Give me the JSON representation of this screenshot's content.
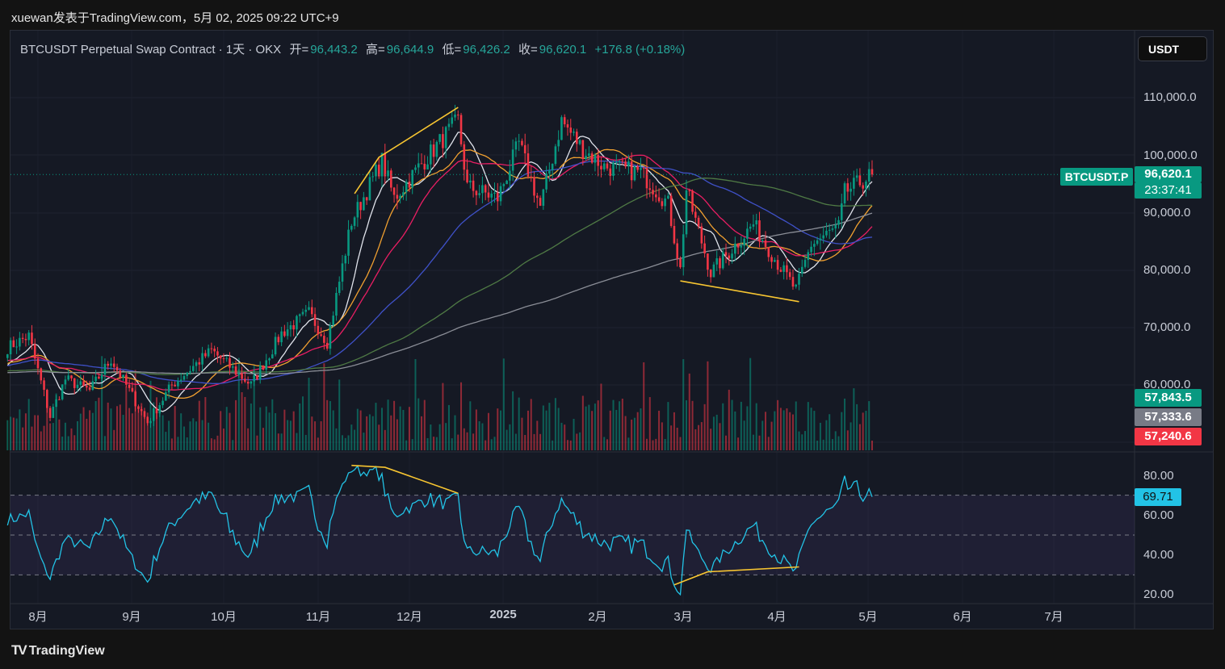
{
  "publisher_line": "xuewan发表于TradingView.com，5月 02, 2025 09:22 UTC+9",
  "legend": {
    "symbol": "BTCUSDT Perpetual Swap Contract · 1天 · OKX",
    "open_label": "开=",
    "open": "96,443.2",
    "high_label": "高=",
    "high": "96,644.9",
    "low_label": "低=",
    "low": "96,426.2",
    "close_label": "收=",
    "close": "96,620.1",
    "change": "+176.8 (+0.18%)"
  },
  "currency_button": "USDT",
  "price_axis": [
    "110,000.0",
    "100,000.0",
    "90,000.0",
    "80,000.0",
    "70,000.0",
    "60,000.0"
  ],
  "symbol_tag": "BTCUSDT.P",
  "last_price": "96,620.1",
  "countdown": "23:37:41",
  "ma_tags": [
    {
      "value": "57,843.5",
      "color": "#089981"
    },
    {
      "value": "57,333.6",
      "color": "#787b86"
    },
    {
      "value": "57,240.6",
      "color": "#f23645"
    }
  ],
  "rsi_axis": [
    "80.00",
    "60.00",
    "40.00",
    "20.00"
  ],
  "rsi_value": "69.71",
  "time_axis": [
    "8月",
    "9月",
    "10月",
    "11月",
    "12月",
    "2025",
    "2月",
    "3月",
    "4月",
    "5月",
    "6月",
    "7月"
  ],
  "brand": "TradingView",
  "colors": {
    "up": "#089981",
    "down": "#f23645",
    "trendline": "#f7c531",
    "rsi": "#22c3e6"
  },
  "chart_data": {
    "type": "candlestick",
    "title": "BTCUSDT Perpetual Swap Contract · 1天 · OKX",
    "y_range": [
      55000,
      115000
    ],
    "rsi_range": [
      15,
      90
    ],
    "rsi_levels": [
      70,
      50,
      30
    ],
    "x_range": [
      "2024-07-22",
      "2025-07-31"
    ],
    "price_path": [
      [
        "2024-07-22",
        66500
      ],
      [
        "2024-07-29",
        68500
      ],
      [
        "2024-08-05",
        54500
      ],
      [
        "2024-08-10",
        61000
      ],
      [
        "2024-08-18",
        59000
      ],
      [
        "2024-08-25",
        64500
      ],
      [
        "2024-09-06",
        53500
      ],
      [
        "2024-09-14",
        60000
      ],
      [
        "2024-09-27",
        66000
      ],
      [
        "2024-10-10",
        60000
      ],
      [
        "2024-10-20",
        69000
      ],
      [
        "2024-10-29",
        72500
      ],
      [
        "2024-11-04",
        67500
      ],
      [
        "2024-11-12",
        88500
      ],
      [
        "2024-11-22",
        99000
      ],
      [
        "2024-11-26",
        92500
      ],
      [
        "2024-12-05",
        98500
      ],
      [
        "2024-12-17",
        106000
      ],
      [
        "2024-12-20",
        94500
      ],
      [
        "2024-12-30",
        92500
      ],
      [
        "2025-01-06",
        102000
      ],
      [
        "2025-01-13",
        91000
      ],
      [
        "2025-01-20",
        106000
      ],
      [
        "2025-01-27",
        101000
      ],
      [
        "2025-02-03",
        98000
      ],
      [
        "2025-02-15",
        97000
      ],
      [
        "2025-02-24",
        91500
      ],
      [
        "2025-02-28",
        80000
      ],
      [
        "2025-03-02",
        94000
      ],
      [
        "2025-03-10",
        79500
      ],
      [
        "2025-03-20",
        85500
      ],
      [
        "2025-03-24",
        88000
      ],
      [
        "2025-03-31",
        82000
      ],
      [
        "2025-04-07",
        76500
      ],
      [
        "2025-04-12",
        84500
      ],
      [
        "2025-04-21",
        87500
      ],
      [
        "2025-04-23",
        93500
      ],
      [
        "2025-05-02",
        96620.1
      ]
    ],
    "moving_averages": [
      {
        "period": 10,
        "color": "#e0e3eb"
      },
      {
        "period": 20,
        "color": "#f0a030"
      },
      {
        "period": 30,
        "color": "#e91e63"
      },
      {
        "period": 60,
        "color": "#3f51c8"
      },
      {
        "period": 120,
        "color": "#4f7a45"
      },
      {
        "period": 200,
        "color": "#8a8d96"
      }
    ],
    "trendlines_price": [
      [
        [
          "2024-11-13",
          93300
        ],
        [
          "2024-11-21",
          99600
        ],
        [
          "2024-12-17",
          108300
        ]
      ],
      [
        [
          "2025-02-28",
          78100
        ],
        [
          "2025-04-08",
          74500
        ]
      ]
    ],
    "trendlines_rsi": [
      [
        [
          "2024-11-12",
          85
        ],
        [
          "2024-11-23",
          84
        ],
        [
          "2024-12-17",
          71
        ]
      ],
      [
        [
          "2025-02-26",
          25
        ],
        [
          "2025-03-09",
          31.5
        ],
        [
          "2025-04-08",
          34
        ]
      ]
    ]
  }
}
